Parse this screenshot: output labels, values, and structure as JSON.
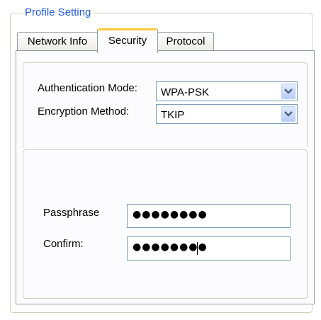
{
  "group_title": "Profile Setting",
  "tabs": [
    {
      "label": "Network Info"
    },
    {
      "label": "Security"
    },
    {
      "label": "Protocol"
    }
  ],
  "active_tab": "Security",
  "security": {
    "auth_mode_label": "Authentication Mode:",
    "auth_mode_value": "WPA-PSK",
    "encryption_label": "Encryption Method:",
    "encryption_value": "TKIP",
    "passphrase_label": "Passphrase",
    "passphrase_value": "●●●●●●●●",
    "confirm_label": "Confirm:",
    "confirm_value": "●●●●●●●●"
  },
  "icons": {
    "dropdown": "chevron-down-icon"
  },
  "colors": {
    "title_blue": "#1f5ad6",
    "active_tab_accent": "#ffc83c",
    "input_border": "#7f9db9",
    "dropdown_arrow": "#4d6185"
  }
}
